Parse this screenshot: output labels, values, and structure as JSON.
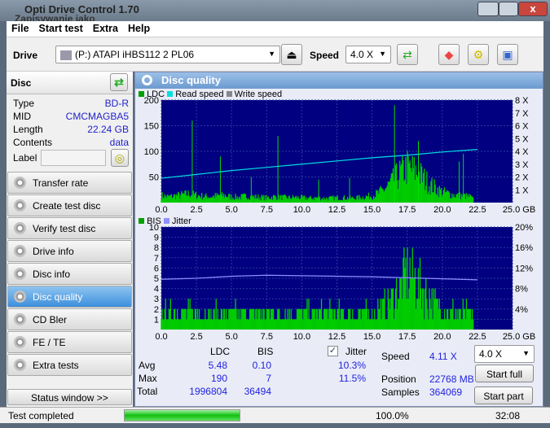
{
  "window": {
    "title": "Opti Drive Control 1.70",
    "subtitle": "Zapisywanie jako"
  },
  "menu": [
    "File",
    "Start test",
    "Extra",
    "Help"
  ],
  "toolbar": {
    "drive_label": "Drive",
    "drive_value": "(P:)   ATAPI iHBS112   2 PL06",
    "speed_label": "Speed",
    "speed_value": "4.0 X"
  },
  "disc": {
    "title": "Disc",
    "rows": [
      {
        "k": "Type",
        "v": "BD-R"
      },
      {
        "k": "MID",
        "v": "CMCMAGBA5"
      },
      {
        "k": "Length",
        "v": "22.24 GB"
      },
      {
        "k": "Contents",
        "v": "data"
      }
    ],
    "label_label": "Label",
    "label_value": ""
  },
  "nav": [
    {
      "label": "Transfer rate"
    },
    {
      "label": "Create test disc"
    },
    {
      "label": "Verify test disc"
    },
    {
      "label": "Drive info"
    },
    {
      "label": "Disc info"
    },
    {
      "label": "Disc quality",
      "selected": true
    },
    {
      "label": "CD Bler"
    },
    {
      "label": "FE / TE"
    },
    {
      "label": "Extra tests"
    }
  ],
  "status_window_label": "Status window >>",
  "panel_title": "Disc quality",
  "colors": {
    "ldc": "#00cc00",
    "bis": "#00cc00",
    "read_speed": "#00e0e0",
    "write_speed": "#888888",
    "jitter": "#9090ff",
    "plot_bg": "#000080",
    "accent": "#2222dd"
  },
  "chart_data": [
    {
      "type": "bar",
      "legend": [
        "LDC",
        "Read speed",
        "Write speed"
      ],
      "xlim": [
        0,
        25
      ],
      "ylim": [
        0,
        200
      ],
      "y2lim": [
        0,
        8
      ],
      "xticks": [
        "0.0",
        "2.5",
        "5.0",
        "7.5",
        "10.0",
        "12.5",
        "15.0",
        "17.5",
        "20.0",
        "22.5",
        "25.0 GB"
      ],
      "yticks": [
        "50",
        "100",
        "150",
        "200"
      ],
      "y2ticks": [
        "1 X",
        "2 X",
        "3 X",
        "4 X",
        "5 X",
        "6 X",
        "7 X",
        "8 X"
      ],
      "ldc_x": [
        0,
        0.5,
        1,
        1.5,
        2,
        2.5,
        3,
        3.5,
        4,
        4.5,
        5,
        5.5,
        6,
        6.5,
        7,
        7.5,
        8,
        8.5,
        9,
        9.5,
        10,
        10.5,
        11,
        11.5,
        12,
        12.5,
        13,
        13.5,
        14,
        14.5,
        15,
        15.5,
        16,
        16.5,
        17,
        17.5,
        18,
        18.5,
        19,
        19.5,
        20,
        20.5,
        21,
        21.5,
        22,
        22.5
      ],
      "ldc_values": [
        15,
        12,
        14,
        16,
        18,
        15,
        13,
        12,
        14,
        15,
        12,
        11,
        13,
        12,
        11,
        10,
        12,
        11,
        10,
        11,
        10,
        9,
        10,
        9,
        9,
        10,
        10,
        9,
        10,
        12,
        14,
        20,
        30,
        45,
        60,
        72,
        65,
        55,
        40,
        30,
        22,
        18,
        15,
        14,
        12,
        0
      ],
      "ldc_spikes": [
        {
          "x": 2.2,
          "y": 160
        },
        {
          "x": 4.2,
          "y": 90
        },
        {
          "x": 6.4,
          "y": 50
        },
        {
          "x": 8.3,
          "y": 130
        },
        {
          "x": 11.2,
          "y": 45
        },
        {
          "x": 13.4,
          "y": 48
        },
        {
          "x": 16.6,
          "y": 190
        },
        {
          "x": 18.3,
          "y": 120
        },
        {
          "x": 21.2,
          "y": 80
        },
        {
          "x": 21.5,
          "y": 95
        }
      ],
      "read_speed_x": [
        0,
        2.5,
        5,
        7.5,
        10,
        12.5,
        15,
        17.5,
        20,
        22.5
      ],
      "read_speed": [
        1.9,
        2.2,
        2.5,
        2.75,
        3.0,
        3.25,
        3.5,
        3.7,
        3.95,
        4.15
      ]
    },
    {
      "type": "bar",
      "legend": [
        "BIS",
        "Jitter"
      ],
      "xlim": [
        0,
        25
      ],
      "ylim": [
        0,
        10
      ],
      "y2lim": [
        0,
        20
      ],
      "xticks": [
        "0.0",
        "2.5",
        "5.0",
        "7.5",
        "10.0",
        "12.5",
        "15.0",
        "17.5",
        "20.0",
        "22.5",
        "25.0 GB"
      ],
      "yticks": [
        "1",
        "2",
        "3",
        "4",
        "5",
        "6",
        "7",
        "8",
        "9",
        "10"
      ],
      "y2ticks": [
        "4%",
        "8%",
        "12%",
        "16%",
        "20%"
      ],
      "bis_x": [
        0,
        1,
        2,
        3,
        4,
        5,
        6,
        7,
        8,
        9,
        10,
        11,
        12,
        13,
        14,
        15,
        16,
        17,
        17.5,
        18,
        18.5,
        19,
        19.5,
        20,
        21,
        22
      ],
      "bis_values": [
        2,
        2,
        2,
        2,
        2,
        2,
        2,
        2,
        2,
        2,
        2,
        2,
        2,
        2,
        2,
        2,
        3,
        5,
        7,
        6,
        5,
        4,
        3,
        3,
        2,
        2
      ],
      "jitter_x": [
        0,
        2.5,
        5,
        7.5,
        10,
        12.5,
        15,
        17.5,
        20,
        22.5
      ],
      "jitter": [
        9.8,
        10.0,
        10.4,
        10.6,
        10.5,
        10.4,
        10.3,
        10.1,
        9.9,
        9.7
      ]
    }
  ],
  "stats": {
    "col_ldc": "LDC",
    "col_bis": "BIS",
    "jitter_label": "Jitter",
    "jitter_checked": true,
    "avg_label": "Avg",
    "avg_ldc": "5.48",
    "avg_bis": "0.10",
    "avg_jitter": "10.3%",
    "max_label": "Max",
    "max_ldc": "190",
    "max_bis": "7",
    "max_jitter": "11.5%",
    "total_label": "Total",
    "total_ldc": "1996804",
    "total_bis": "36494",
    "speed_label": "Speed",
    "speed_value": "4.11 X",
    "position_label": "Position",
    "position_value": "22768 MB",
    "samples_label": "Samples",
    "samples_value": "364069",
    "speed_select": "4.0 X",
    "start_full": "Start full",
    "start_part": "Start part"
  },
  "statusbar": {
    "text": "Test completed",
    "progress": 100,
    "progress_text": "100.0%",
    "time": "32:08"
  }
}
